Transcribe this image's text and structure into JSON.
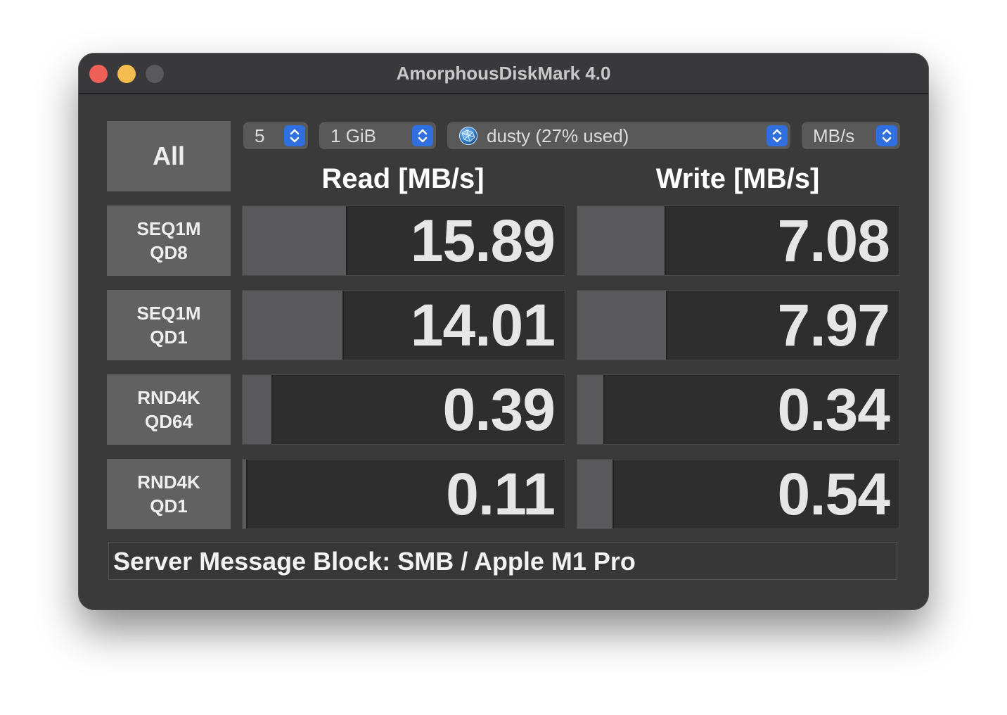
{
  "window": {
    "title": "AmorphousDiskMark 4.0"
  },
  "controls": {
    "all_label": "All",
    "count_value": "5",
    "size_value": "1 GiB",
    "target_value": "dusty  (27% used)",
    "unit_value": "MB/s"
  },
  "headers": {
    "read": "Read [MB/s]",
    "write": "Write [MB/s]"
  },
  "rows": [
    {
      "line1": "SEQ1M",
      "line2": "QD8",
      "read": "15.89",
      "write": "7.08",
      "read_fill": 0.32,
      "write_fill": 0.27
    },
    {
      "line1": "SEQ1M",
      "line2": "QD1",
      "read": "14.01",
      "write": "7.97",
      "read_fill": 0.31,
      "write_fill": 0.275
    },
    {
      "line1": "RND4K",
      "line2": "QD64",
      "read": "0.39",
      "write": "0.34",
      "read_fill": 0.09,
      "write_fill": 0.08
    },
    {
      "line1": "RND4K",
      "line2": "QD1",
      "read": "0.11",
      "write": "0.54",
      "read_fill": 0.012,
      "write_fill": 0.11
    }
  ],
  "status": {
    "text": "Server Message Block: SMB / Apple M1 Pro"
  },
  "icons": {
    "count_stepper": "up-down-chevron-icon",
    "size_stepper": "up-down-chevron-icon",
    "target_stepper": "up-down-chevron-icon",
    "unit_stepper": "up-down-chevron-icon",
    "target_icon": "network-globe-icon"
  },
  "colors": {
    "stepper_accent": "#2f6fe0",
    "close": "#ee5f57",
    "minimize": "#f5bd4f",
    "maximize_inactive": "#59585a"
  }
}
